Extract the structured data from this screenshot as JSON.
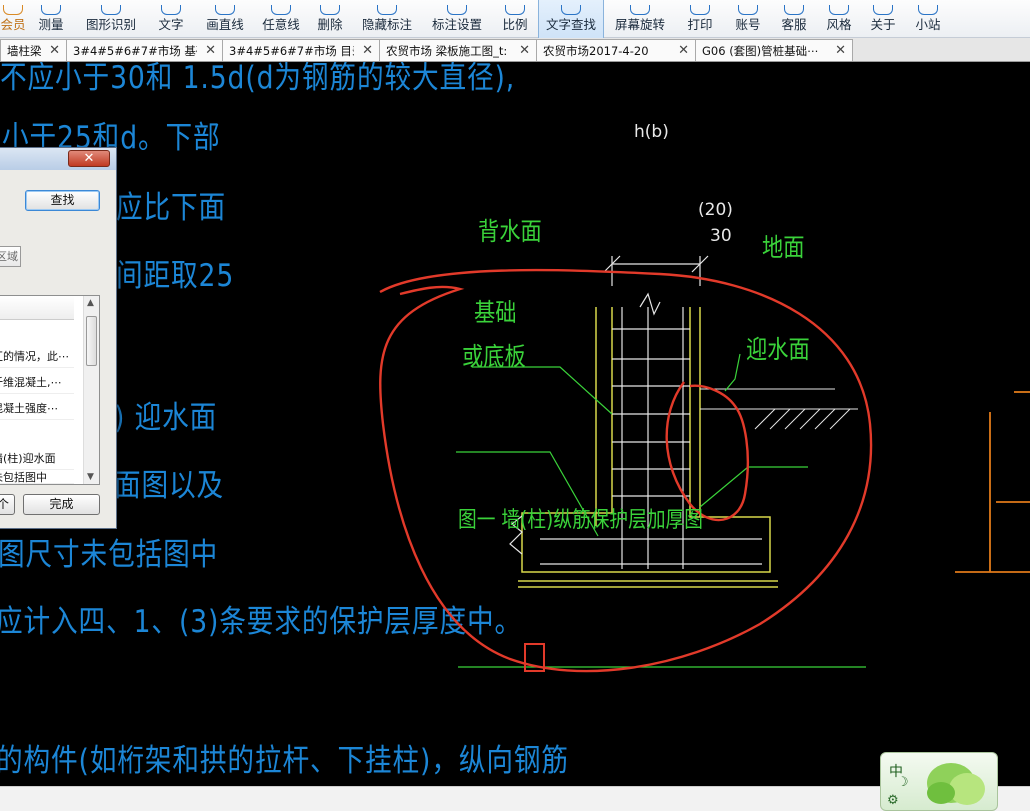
{
  "toolbar": {
    "items": [
      {
        "label": "会员"
      },
      {
        "label": "测量"
      },
      {
        "label": "图形识别"
      },
      {
        "label": "文字"
      },
      {
        "label": "画直线"
      },
      {
        "label": "任意线"
      },
      {
        "label": "删除"
      },
      {
        "label": "隐藏标注"
      },
      {
        "label": "标注设置"
      },
      {
        "label": "比例"
      },
      {
        "label": "文字查找"
      },
      {
        "label": "屏幕旋转"
      },
      {
        "label": "打印"
      },
      {
        "label": "账号"
      },
      {
        "label": "客服"
      },
      {
        "label": "风格"
      },
      {
        "label": "关于"
      },
      {
        "label": "小站"
      }
    ],
    "active": "文字查找"
  },
  "tabs": [
    {
      "label": "墙柱梁⋯"
    },
    {
      "label": "3#4#5#6#7#市场 基础⋯"
    },
    {
      "label": "3#4#5#6#7#市场 目录"
    },
    {
      "label": "农贸市场 梁板施工图_t:"
    },
    {
      "label": "农贸市场2017-4-20"
    },
    {
      "label": "G06 (套图)管桩基础⋯"
    }
  ],
  "drawing_text": {
    "lines": [
      "不应小于30和 1.5d(d为钢筋的较大直径),",
      "小于25和d。下部",
      "应比下面",
      "间距取25",
      ") 迎水面",
      "面图以及",
      "图尺寸未包括图中",
      "应计入四、1、(3)条要求的保护层厚度中。",
      "的构件(如桁架和拱的拉杆、下挂柱)，纵向钢筋"
    ],
    "labels": {
      "back_face": "背水面",
      "foundation_1": "基础",
      "foundation_2": "或底板",
      "ground": "地面",
      "water_face": "迎水面",
      "dim_h": "h(b)",
      "dim_20": "(20)",
      "dim_30": "30",
      "caption": "图一 墙(柱)纵筋保护层加厚图"
    }
  },
  "dialog": {
    "close_label": "✕",
    "find_button": "查找",
    "region_button": "区域",
    "list_items": [
      "汇的情况，此⋯",
      "纤维混凝土,⋯",
      "混凝土强度⋯",
      "墙(柱)迎水面",
      "未包括图中"
    ],
    "prev_button": "个",
    "done_button": "完成"
  },
  "ime": {
    "label": "中"
  }
}
